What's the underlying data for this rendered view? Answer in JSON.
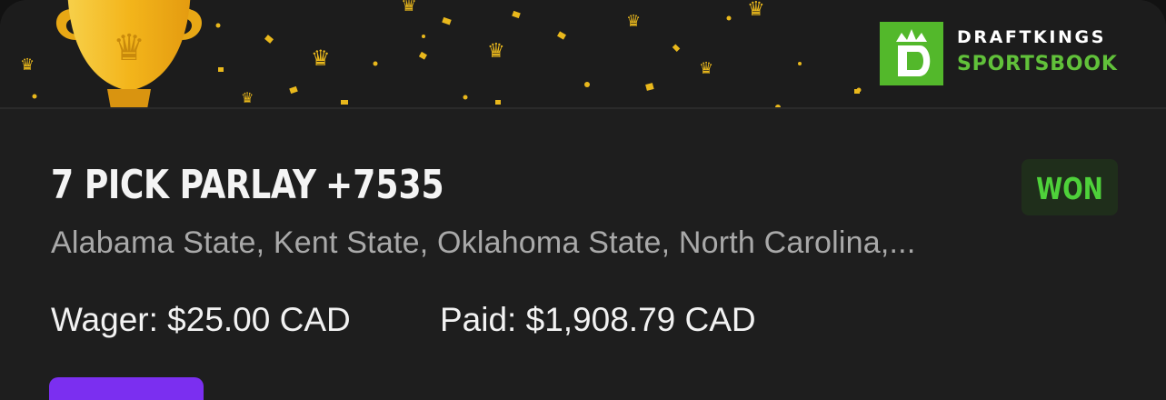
{
  "brand": {
    "line1": "DRAFTKINGS",
    "line2": "SPORTSBOOK",
    "badge_color": "#53b82b",
    "accent_green": "#61c13a"
  },
  "bet": {
    "title": "7 PICK PARLAY",
    "odds": "+7535",
    "status": "WON",
    "status_color": "#4ed13a",
    "legs_summary": "Alabama State, Kent State, Oklahoma State, North Carolina,...",
    "wager_label": "Wager:",
    "wager_value": "$25.00 CAD",
    "paid_label": "Paid:",
    "paid_value": "$1,908.79 CAD"
  },
  "icons": {
    "trophy": "trophy-icon",
    "crown": "crown-icon",
    "logo": "draftkings-logo-icon"
  },
  "theme": {
    "background": "#1e1e1e",
    "confetti": "#f4c21b",
    "action_button": "#7b2ff0"
  }
}
